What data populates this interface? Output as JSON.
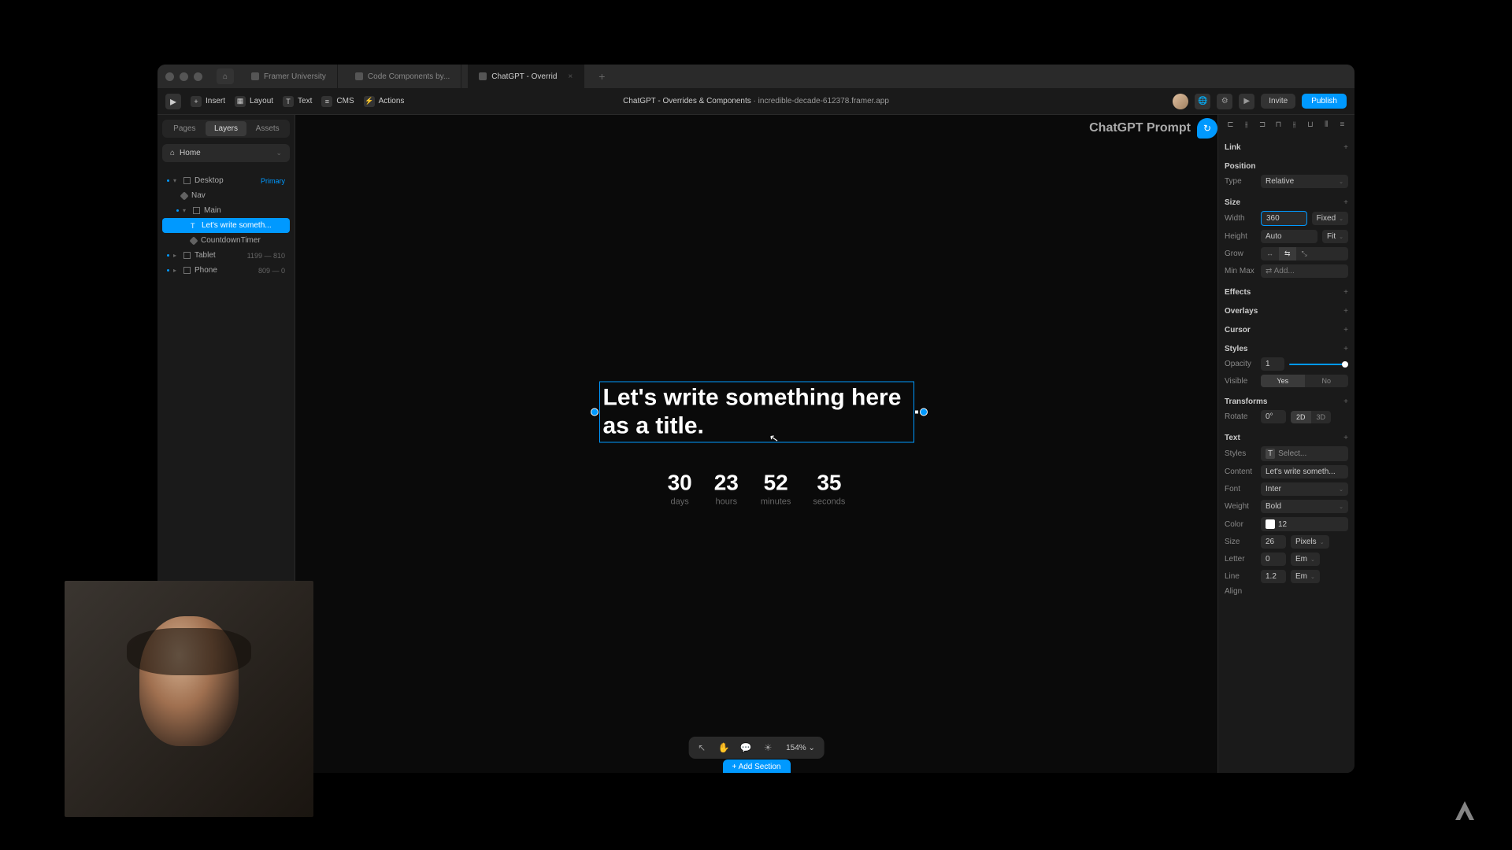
{
  "tabs": [
    {
      "label": "Framer University"
    },
    {
      "label": "Code Components by..."
    },
    {
      "label": "ChatGPT - Overrid"
    }
  ],
  "toolbar": {
    "insert": "Insert",
    "layout": "Layout",
    "text": "Text",
    "cms": "CMS",
    "actions": "Actions",
    "project": "ChatGPT - Overrides & Components",
    "url": "incredible-decade-612378.framer.app",
    "invite": "Invite",
    "publish": "Publish"
  },
  "leftPanel": {
    "tabs": {
      "pages": "Pages",
      "layers": "Layers",
      "assets": "Assets"
    },
    "page": "Home",
    "layers": {
      "desktop": "Desktop",
      "primary": "Primary",
      "nav": "Nav",
      "main": "Main",
      "title": "Let's write someth...",
      "countdown": "CountdownTimer",
      "tablet": "Tablet",
      "tabletMeta": "1199 — 810",
      "phone": "Phone",
      "phoneMeta": "809 — 0"
    }
  },
  "canvas": {
    "title": "Let's write something here as a title.",
    "countdown": {
      "days_v": "30",
      "days_l": "days",
      "hours_v": "23",
      "hours_l": "hours",
      "min_v": "52",
      "min_l": "minutes",
      "sec_v": "35",
      "sec_l": "seconds"
    },
    "prompt": "ChatGPT Prompt",
    "zoom": "154%",
    "addSection": "+ Add Section"
  },
  "rightPanel": {
    "link": "Link",
    "position": "Position",
    "type": "Type",
    "typeVal": "Relative",
    "size": "Size",
    "width": "Width",
    "widthVal": "360",
    "widthFixed": "Fixed",
    "height": "Height",
    "heightVal": "Auto",
    "heightFit": "Fit",
    "grow": "Grow",
    "minmax": "Min Max",
    "minmaxVal": "Add...",
    "effects": "Effects",
    "overlays": "Overlays",
    "cursor": "Cursor",
    "styles": "Styles",
    "opacity": "Opacity",
    "opacityVal": "1",
    "visible": "Visible",
    "yes": "Yes",
    "no": "No",
    "transforms": "Transforms",
    "rotate": "Rotate",
    "rotateVal": "0°",
    "d2": "2D",
    "d3": "3D",
    "text": "Text",
    "tstyles": "Styles",
    "tstylesVal": "Select...",
    "content": "Content",
    "contentVal": "Let's write someth...",
    "font": "Font",
    "fontVal": "Inter",
    "weight": "Weight",
    "weightVal": "Bold",
    "color": "Color",
    "colorVal": "12",
    "tsize": "Size",
    "tsizeVal": "26",
    "pixels": "Pixels",
    "letter": "Letter",
    "letterVal": "0",
    "em": "Em",
    "line": "Line",
    "lineVal": "1.2",
    "align": "Align"
  }
}
